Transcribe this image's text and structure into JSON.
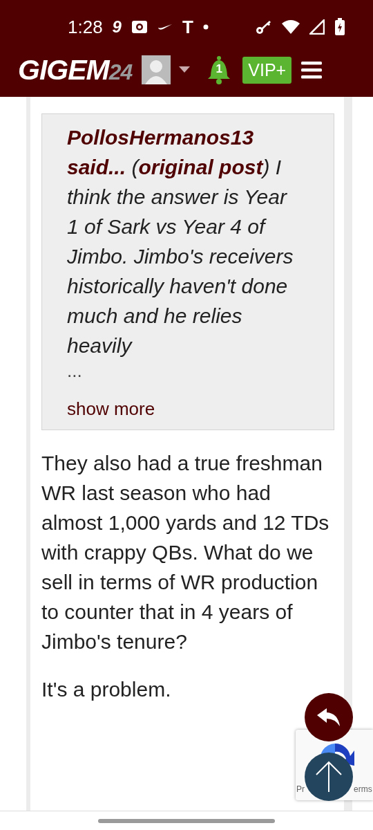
{
  "status_bar": {
    "time": "1:28",
    "glyphs": [
      "9",
      "T"
    ]
  },
  "header": {
    "logo_main": "GIGEM",
    "logo_suffix": "24",
    "notification_count": "1",
    "vip_label": "VIP+"
  },
  "quote": {
    "author": "**PollosHermanos13 said...** (",
    "link": "original post",
    "text": ") I think the answer is Year 1 of Sark vs Year 4 of Jimbo. Jimbo's receivers historically haven't done much and he relies heavily",
    "ellipsis": "...",
    "show_more": "show more"
  },
  "paragraphs": [
    "They also had a true freshman WR last season who had almost 1,000 yards and 12 TDs with crappy QBs. What do we sell in terms of WR production to counter that in 4 years of Jimbo's tenure?",
    "It's a problem."
  ],
  "recaptcha": {
    "left_text": "Pr",
    "right_text": "erms"
  }
}
